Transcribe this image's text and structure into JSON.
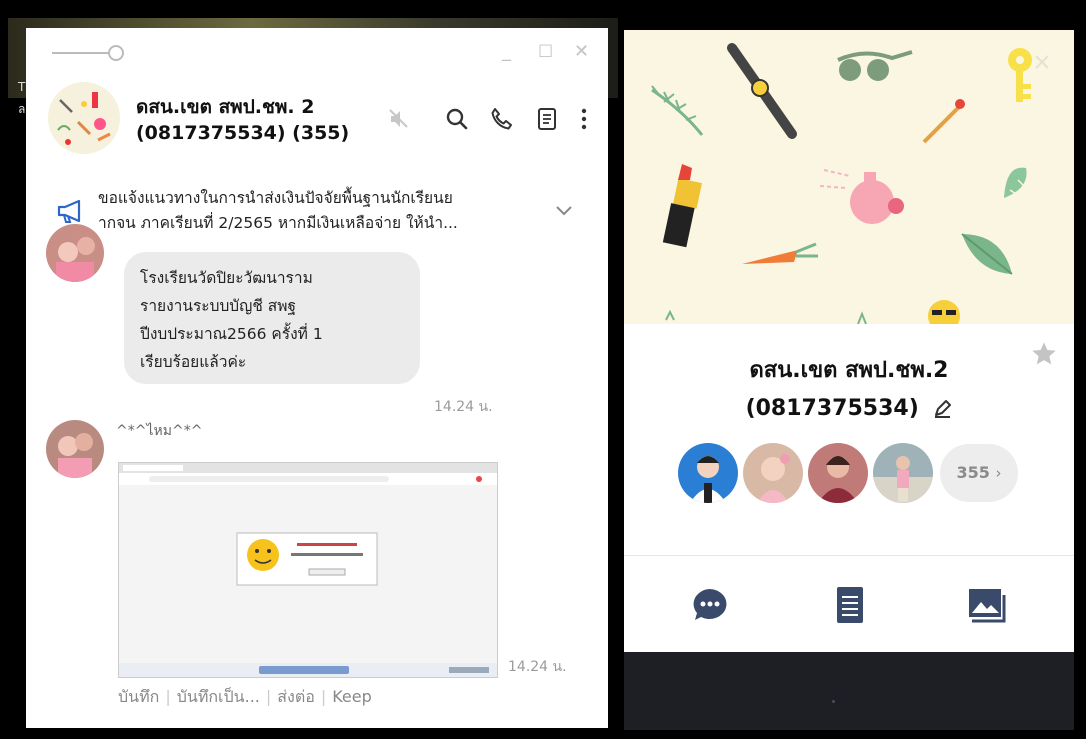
{
  "desktop": {
    "chars": [
      "T",
      "ล"
    ]
  },
  "window_controls": {
    "minimize": "_",
    "maximize": "☐",
    "close": "✕"
  },
  "chat": {
    "title": "ดสน.เขต สพป.ชพ. 2 (0817375534) (355)",
    "announcement": {
      "line1": "ขอแจ้งแนวทางในการนำส่งเงินปัจจัยพื้นฐานนักเรียนย",
      "line2": "ากจน ภาคเรียนที่ 2/2565 หากมีเงินเหลือจ่าย ให้นำ..."
    },
    "messages": [
      {
        "lines": [
          "โรงเรียนวัดปิยะวัฒนาราม",
          "รายงานระบบบัญชี สพฐ",
          "ปีงบประมาณ2566 ครั้งที่ 1",
          "เรียบร้อยแล้วค่ะ"
        ],
        "time": "14.24 น."
      },
      {
        "sender": "^*^ไหม^*^",
        "time": "14.24 น.",
        "actions": [
          "บันทึก",
          "บันทึกเป็น...",
          "ส่งต่อ",
          "Keep"
        ]
      }
    ]
  },
  "profile": {
    "name_line1": "ดสน.เขต สพป.ชพ.2",
    "name_line2": "(0817375534)",
    "member_count": "355",
    "count_chevron": "›"
  },
  "icons": [
    "mute-icon",
    "search-icon",
    "call-icon",
    "notes-icon",
    "more-icon",
    "megaphone-icon",
    "chevron-down-icon",
    "star-icon",
    "edit-icon",
    "chat-icon",
    "note-icon",
    "album-icon"
  ],
  "colors": {
    "accent": "#3a4a6b",
    "bubble": "#ebebeb",
    "cover_bg": "#fbf6e1",
    "time_text": "#9b9b9b"
  }
}
